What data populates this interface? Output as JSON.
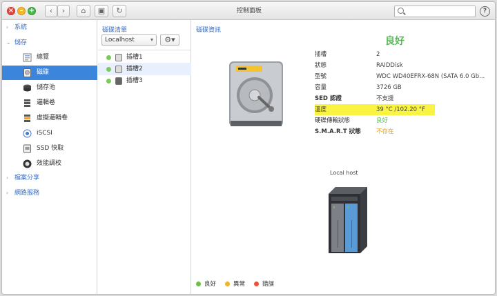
{
  "window": {
    "title": "控制面板"
  },
  "toolbar": {
    "back": "‹",
    "forward": "›",
    "home": "⌂",
    "panel": "▣",
    "refresh": "↻",
    "help": "?"
  },
  "sidebar": {
    "sections": [
      {
        "label": "系統",
        "expanded": false
      },
      {
        "label": "儲存",
        "expanded": true
      },
      {
        "label": "檔案分享",
        "expanded": false
      },
      {
        "label": "網路服務",
        "expanded": false
      }
    ],
    "items": [
      {
        "label": "總覽",
        "icon": "overview-icon"
      },
      {
        "label": "磁碟",
        "icon": "disk-icon",
        "active": true
      },
      {
        "label": "儲存池",
        "icon": "storage-pool-icon"
      },
      {
        "label": "邏輯卷",
        "icon": "logical-volume-icon"
      },
      {
        "label": "虛擬邏輯卷",
        "icon": "virtual-volume-icon"
      },
      {
        "label": "iSCSI",
        "icon": "iscsi-icon"
      },
      {
        "label": "SSD 快取",
        "icon": "ssd-cache-icon"
      },
      {
        "label": "效能調校",
        "icon": "performance-icon"
      }
    ]
  },
  "disk_list": {
    "header": "磁碟清單",
    "host_select": "Localhost",
    "slots": [
      {
        "label": "插槽1",
        "status": "good",
        "type": "hdd"
      },
      {
        "label": "插槽2",
        "status": "good",
        "type": "hdd",
        "selected": true
      },
      {
        "label": "插槽3",
        "status": "good",
        "type": "ssd"
      }
    ]
  },
  "disk_info": {
    "header": "磁碟資訊",
    "overall_status": "良好",
    "rows": [
      {
        "key": "插槽",
        "value": "2"
      },
      {
        "key": "狀態",
        "value": "RAIDDisk"
      },
      {
        "key": "型號",
        "value": "WDC WD40EFRX-68N (SATA 6.0 Gb..."
      },
      {
        "key": "容量",
        "value": "3726 GB"
      },
      {
        "key": "SED 認證",
        "value": "不支援"
      },
      {
        "key": "溫度",
        "value": "39 °C /102.20 °F",
        "highlight": true
      },
      {
        "key": "硬碟傳輸狀態",
        "value": "良好",
        "tone": "good"
      },
      {
        "key": "S.M.A.R.T 狀態",
        "value": "不存在",
        "tone": "warn"
      }
    ],
    "host_label": "Local host"
  },
  "legend": [
    {
      "label": "良好",
      "color": "#6cc04a"
    },
    {
      "label": "異常",
      "color": "#f0b429"
    },
    {
      "label": "錯誤",
      "color": "#e9553b"
    }
  ],
  "colors": {
    "accent": "#3b85dc",
    "good": "#5cb85c",
    "warn": "#e6a21a",
    "highlight": "#f9f442"
  }
}
